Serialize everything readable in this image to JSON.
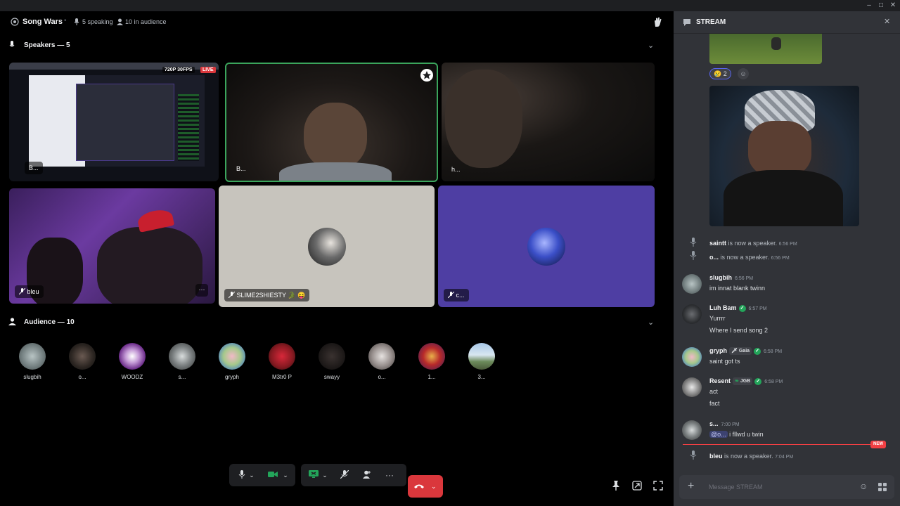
{
  "stage": {
    "title": "Song Wars",
    "speaking": "5 speaking",
    "audience_count": "10 in audience",
    "speakers_label": "Speakers — 5",
    "audience_label": "Audience — 10"
  },
  "speakers": [
    {
      "label": "B...",
      "badges": [
        "720P 30FPS",
        "LIVE"
      ]
    },
    {
      "label": "B..."
    },
    {
      "label": "h..."
    },
    {
      "label": "bleu"
    },
    {
      "label": "SLIME2SHIESTY 🐊 😝"
    },
    {
      "label": "c..."
    }
  ],
  "audience": [
    {
      "name": "slugbih"
    },
    {
      "name": "o..."
    },
    {
      "name": "WOODZ"
    },
    {
      "name": "s..."
    },
    {
      "name": "gryph"
    },
    {
      "name": "M3tr0 P"
    },
    {
      "name": "swayy"
    },
    {
      "name": "o..."
    },
    {
      "name": "1..."
    },
    {
      "name": "3..."
    }
  ],
  "chat": {
    "title": "STREAM",
    "reaction_count": "2",
    "system": [
      {
        "user": "saintt",
        "text": "is now a speaker.",
        "time": "6:56 PM"
      },
      {
        "user": "o...",
        "text": "is now a speaker.",
        "time": "6:56 PM"
      },
      {
        "user": "bleu",
        "text": "is now a speaker.",
        "time": "7:04 PM"
      }
    ],
    "messages": [
      {
        "user": "slugbih",
        "time": "6:56 PM",
        "lines": [
          "im innat blank twinn"
        ]
      },
      {
        "user": "Luh Bam",
        "time": "6:57 PM",
        "lines": [
          "Yurrrr",
          "Where I send song  2"
        ]
      },
      {
        "user": "gryph",
        "tag": "Gaia",
        "time": "6:58 PM",
        "lines": [
          "saint got ts"
        ]
      },
      {
        "user": "Resent",
        "tag": "JGB",
        "time": "6:58 PM",
        "lines": [
          "act",
          "fact"
        ]
      },
      {
        "user": "s...",
        "time": "7:00 PM",
        "mention": "@o...",
        "lines": [
          " i fllwd u twin"
        ]
      }
    ],
    "new_label": "NEW",
    "composer_placeholder": "Message STREAM"
  },
  "colors": {
    "end_call": "#da373c",
    "screen_share": "#23a55a",
    "speaking_ring": "#3ba55c",
    "new_divider": "#f23f43"
  }
}
